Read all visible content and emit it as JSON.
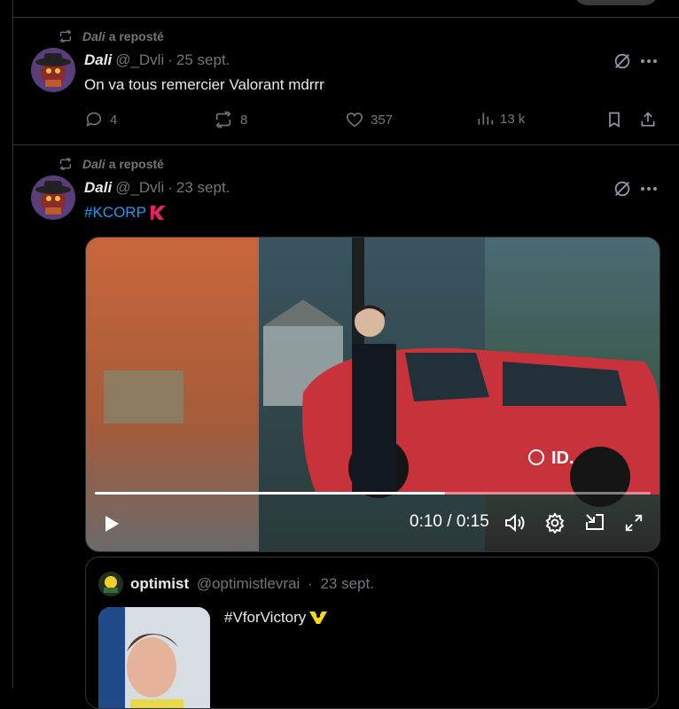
{
  "tweets": [
    {
      "repost_user": "Dali",
      "repost_suffix": "a reposté",
      "author_name": "Dali",
      "author_handle": "@_Dvli",
      "date": "25 sept.",
      "text": "On va tous remercier Valorant mdrrr",
      "replies": "4",
      "reposts": "8",
      "likes": "357",
      "views": "13 k"
    },
    {
      "repost_user": "Dali",
      "repost_suffix": "a reposté",
      "author_name": "Dali",
      "author_handle": "@_Dvli",
      "date": "23 sept.",
      "text": "#KCORP",
      "video": {
        "time_label": "0:10 / 0:15",
        "progress": 0.63
      },
      "quote": {
        "author_name": "optimist",
        "author_handle": "@optimistlevrai",
        "date": "23 sept.",
        "text": "#VforVictory"
      }
    }
  ],
  "colors": {
    "background": "#000000",
    "border": "#2f3336",
    "muted": "#71767b",
    "text": "#e7e9ea",
    "link": "#1d9bf0",
    "kcorp_red": "#e0245e",
    "vitality_yellow": "#f5d71c"
  },
  "icons": [
    "repost-icon",
    "grok-icon",
    "more-icon",
    "reply-icon",
    "like-icon",
    "views-icon",
    "bookmark-icon",
    "share-icon",
    "play-icon",
    "volume-icon",
    "settings-icon",
    "pip-icon",
    "fullscreen-icon"
  ]
}
